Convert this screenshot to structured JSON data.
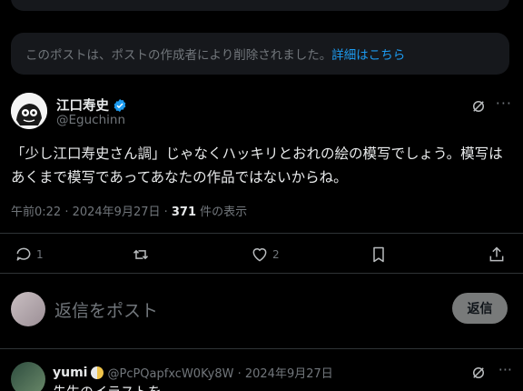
{
  "deleted_notice": {
    "text": "このポストは、ポストの作成者により削除されました。",
    "link": "詳細はこちら"
  },
  "post": {
    "author_name": "江口寿史",
    "author_handle": "@Eguchinn",
    "verified": true,
    "body": "「少し江口寿史さん調」じゃなくハッキリとおれの絵の模写でしょう。模写はあくまで模写であってあなたの作品ではないからね。",
    "timestamp": "午前0:22 · 2024年9月27日 · ",
    "views_count": "371",
    "views_label": " 件の表示",
    "more_label": "···"
  },
  "actions": {
    "reply_count": "1",
    "repost_count": "",
    "like_count": "2"
  },
  "reply_box": {
    "placeholder": "返信をポスト",
    "button": "返信"
  },
  "reply": {
    "name": "yumi",
    "handle_date": "@PcPQapfxcW0Ky8W · 2024年9月27日",
    "text_partial": "先生のイラストを",
    "more_label": "···"
  },
  "colors": {
    "accent": "#1d9bf0",
    "muted": "#71767b",
    "text": "#e7e9ea",
    "bg": "#000000"
  }
}
